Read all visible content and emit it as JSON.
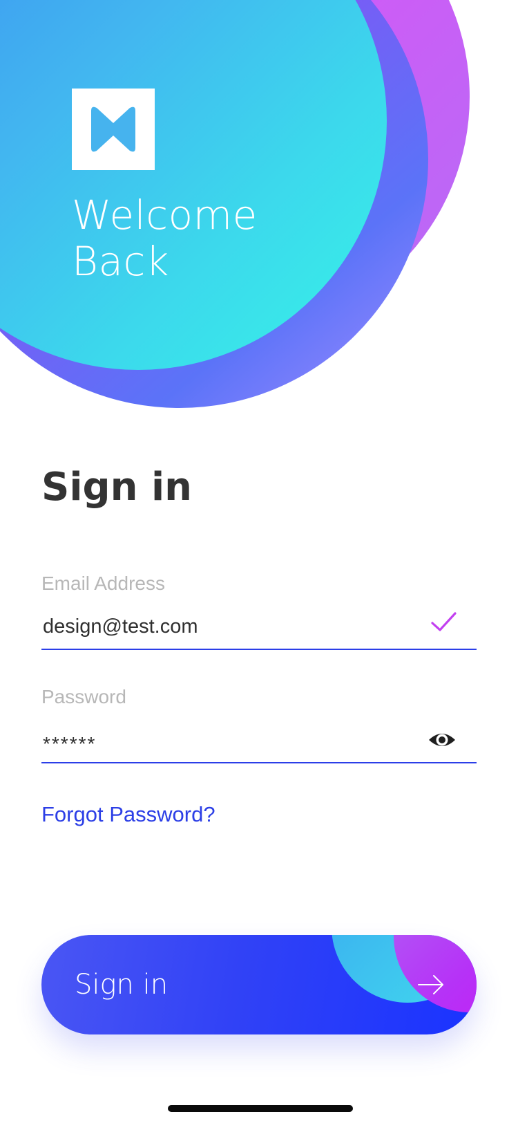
{
  "hero": {
    "welcome_line1": "Welcome",
    "welcome_line2": "Back"
  },
  "logo": {
    "icon": "m-logo-icon"
  },
  "signin": {
    "title": "Sign in"
  },
  "form": {
    "email": {
      "label": "Email Address",
      "value": "design@test.com",
      "status_icon": "check-icon"
    },
    "password": {
      "label": "Password",
      "value": "******",
      "toggle_icon": "eye-icon"
    }
  },
  "forgot_password": "Forgot Password?",
  "button": {
    "label": "Sign in",
    "icon": "arrow-right-icon"
  },
  "colors": {
    "accent_blue": "#2b3ee8",
    "check_purple": "#c240f0",
    "title_gray": "#333333",
    "label_gray": "#b7b7b7"
  }
}
